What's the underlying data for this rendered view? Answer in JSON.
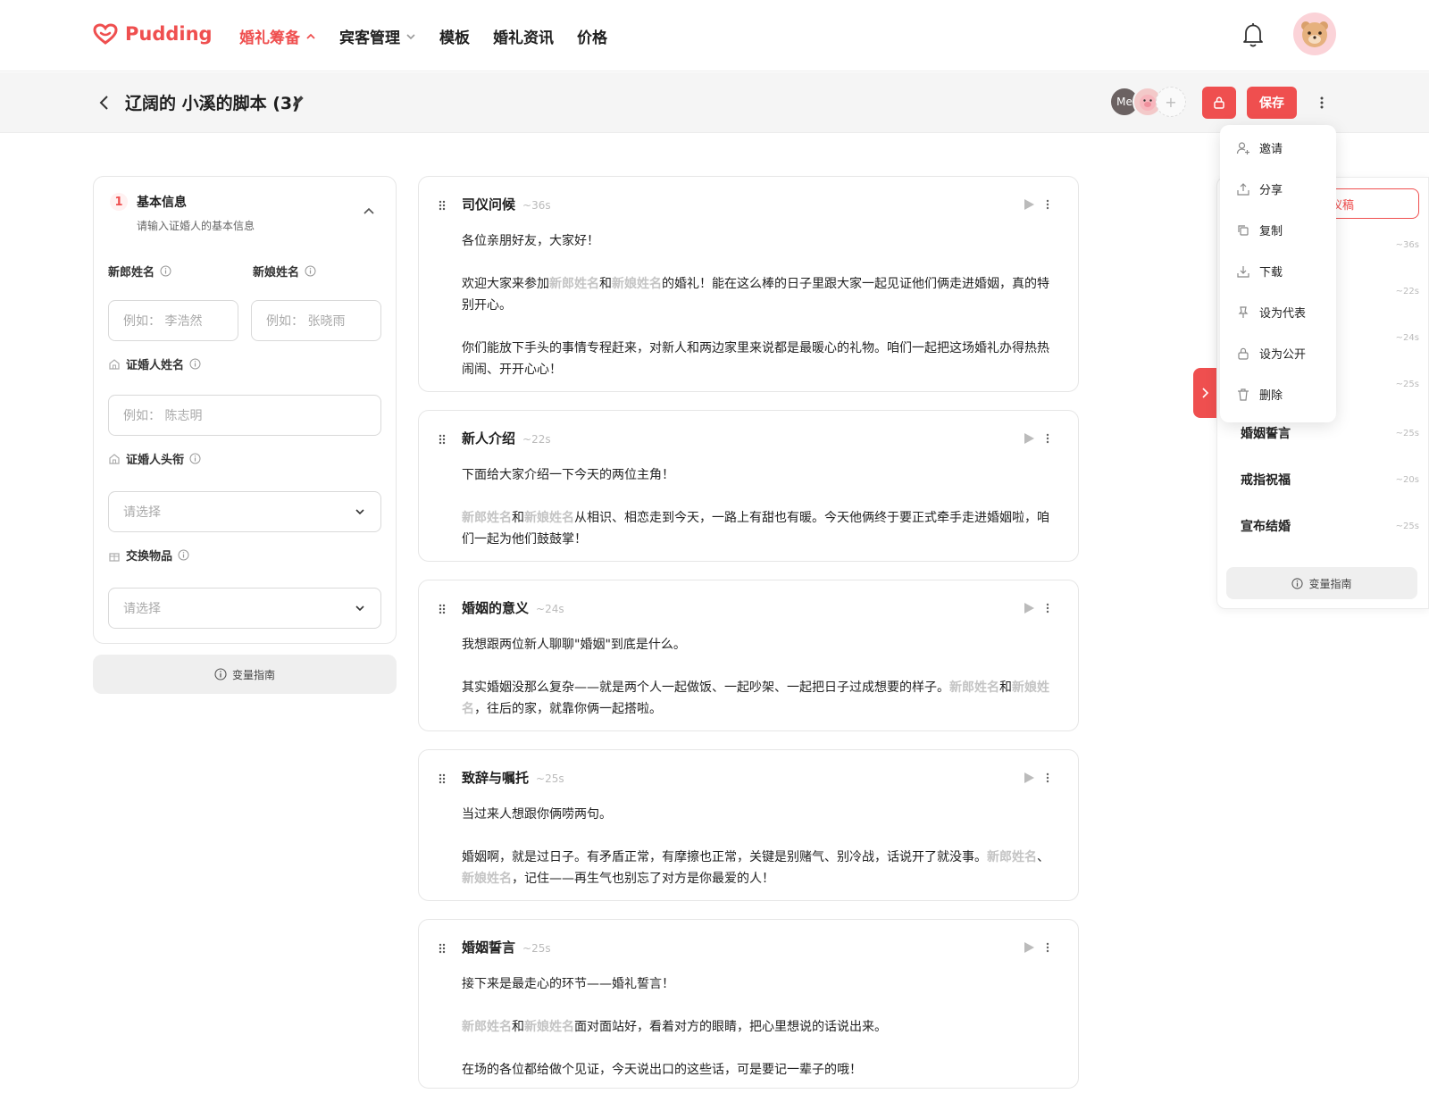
{
  "brand": {
    "name": "Pudding",
    "color": "#ef4f4f"
  },
  "nav": {
    "items": [
      {
        "label": "婚礼筹备",
        "active": true,
        "has_caret": true
      },
      {
        "label": "宾客管理",
        "active": false,
        "has_caret": true
      },
      {
        "label": "模板",
        "active": false,
        "has_caret": false
      },
      {
        "label": "婚礼资讯",
        "active": false,
        "has_caret": false
      },
      {
        "label": "价格",
        "active": false,
        "has_caret": false
      }
    ],
    "icons": {
      "bell": "bell-icon",
      "avatar": "bear-avatar"
    }
  },
  "doc": {
    "title": "辽阔的 小溪的脚本 (3)",
    "collaborators": [
      {
        "label": "Me"
      },
      {
        "label": "pig-avatar"
      },
      {
        "label": "+"
      }
    ],
    "save_label": "保存"
  },
  "form": {
    "step": "1",
    "title": "基本信息",
    "subtitle": "请输入证婚人的基本信息",
    "groom_label": "新郎姓名",
    "groom_placeholder": "例如： 李浩然",
    "bride_label": "新娘姓名",
    "bride_placeholder": "例如： 张晓雨",
    "officiant_label": "证婚人姓名",
    "officiant_placeholder": "例如： 陈志明",
    "title_label": "证婚人头衔",
    "title_placeholder": "请选择",
    "exchange_label": "交换物品",
    "exchange_placeholder": "请选择",
    "guide": "变量指南"
  },
  "vars": {
    "groom": "新郎姓名",
    "bride": "新娘姓名"
  },
  "cards": [
    {
      "title": "司仪问候",
      "dur": "~36s"
    },
    {
      "title": "新人介绍",
      "dur": "~22s"
    },
    {
      "title": "婚姻的意义",
      "dur": "~24s"
    },
    {
      "title": "致辞与嘱托",
      "dur": "~25s"
    },
    {
      "title": "婚姻誓言",
      "dur": "~25s"
    }
  ],
  "text": {
    "c1p1": "各位亲朋好友，大家好！",
    "c1p2a": "欢迎大家来参加",
    "c1p2b": "和",
    "c1p2c": "的婚礼！能在这么棒的日子里跟大家一起见证他们俩走进婚姻，真的特别开心。",
    "c1p3": "你们能放下手头的事情专程赶来，对新人和两边家里来说都是最暖心的礼物。咱们一起把这场婚礼办得热热闹闹、开开心心！",
    "c2p1": "下面给大家介绍一下今天的两位主角！",
    "c2p2b": "和",
    "c2p2c": "从相识、相恋走到今天，一路上有甜也有暖。今天他俩终于要正式牵手走进婚姻啦，咱们一起为他们鼓鼓掌！",
    "c3p1": "我想跟两位新人聊聊\"婚姻\"到底是什么。",
    "c3p2a": "其实婚姻没那么复杂——就是两个人一起做饭、一起吵架、一起把日子过成想要的样子。",
    "c3p2b": "和",
    "c3p2c": "，往后的家，就靠你俩一起搭啦。",
    "c4p1": "当过来人想跟你俩唠两句。",
    "c4p2a": "婚姻啊，就是过日子。有矛盾正常，有摩擦也正常，关键是别赌气、别冷战，话说开了就没事。",
    "c4p2b": "、",
    "c4p2c": "，记住——再生气也别忘了对方是你最爱的人！",
    "c5p1": "接下来是最走心的环节——婚礼誓言！",
    "c5p2b": "和",
    "c5p2c": "面对面站好，看着对方的眼睛，把心里想说的话说出来。",
    "c5p3": "在场的各位都给做个见证，今天说出口的这些话，可是要记一辈子的哦！"
  },
  "outline": {
    "button": "仪稿",
    "items": [
      {
        "title": "",
        "dur": "~36s"
      },
      {
        "title": "",
        "dur": "~22s"
      },
      {
        "title": "",
        "dur": "~24s"
      },
      {
        "title": "",
        "dur": "~25s"
      },
      {
        "title": "婚姻誓言",
        "dur": "~25s"
      },
      {
        "title": "戒指祝福",
        "dur": "~20s"
      },
      {
        "title": "宣布结婚",
        "dur": "~25s"
      }
    ],
    "guide": "变量指南"
  },
  "menu": {
    "items": [
      {
        "label": "邀请",
        "icon": "user-add-icon"
      },
      {
        "label": "分享",
        "icon": "share-icon"
      },
      {
        "label": "复制",
        "icon": "copy-icon"
      },
      {
        "label": "下载",
        "icon": "download-icon"
      },
      {
        "label": "设为代表",
        "icon": "pin-icon"
      },
      {
        "label": "设为公开",
        "icon": "lock-icon"
      },
      {
        "label": "删除",
        "icon": "trash-icon"
      }
    ]
  }
}
